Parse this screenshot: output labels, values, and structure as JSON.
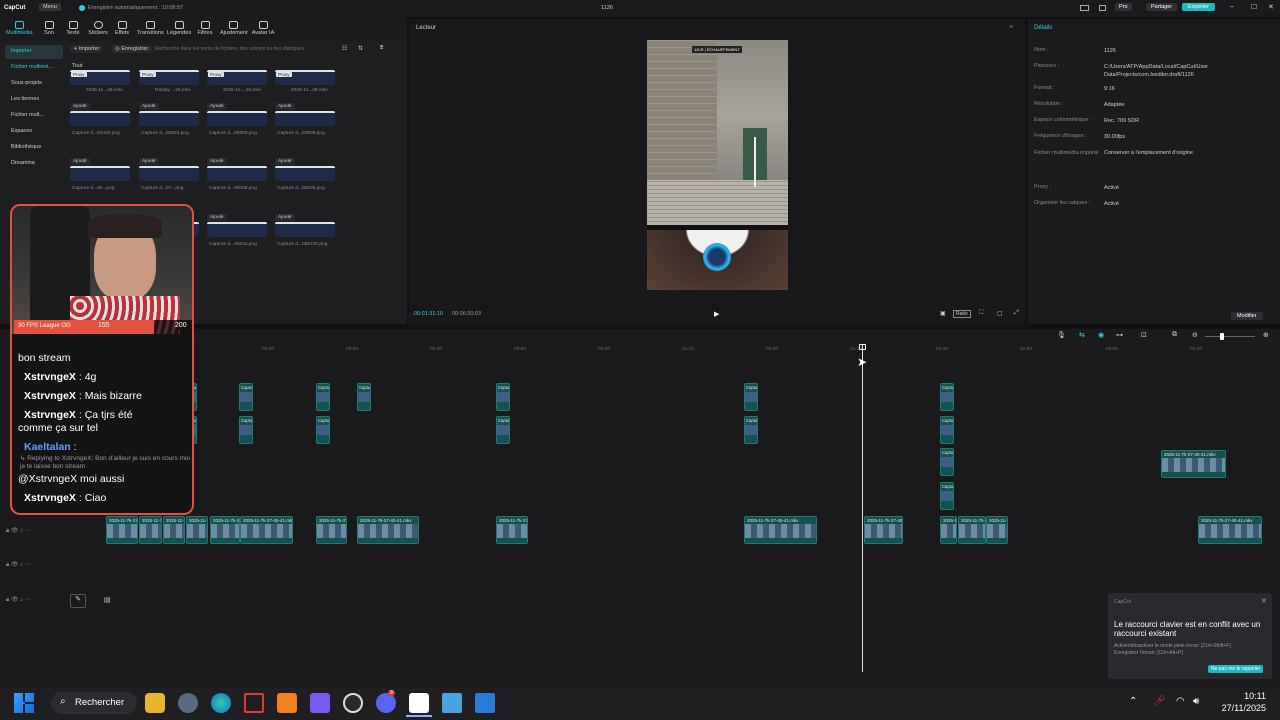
{
  "titlebar": {
    "app_name": "CapCut",
    "menu_label": "Menu",
    "autosave": "Enregistré automatiquement : 10:08:57",
    "project_name": "1126",
    "pro_label": "Pro",
    "share_label": "Partager",
    "export_label": "Exporter"
  },
  "toolbar": [
    "Multimédia",
    "Son",
    "Texte",
    "Stickers",
    "Effets",
    "Transitions",
    "Légendes",
    "Filtres",
    "Ajustement",
    "Avatar IA"
  ],
  "sidenav": [
    "Importer",
    "Fichier multimé...",
    "Sous-projets",
    "Les tiennes",
    "Fichier mult...",
    "Espaces",
    "Bibliothèque",
    "Dreamina"
  ],
  "media": {
    "import_btn": "Importer",
    "record_btn": "Enregistrer",
    "search_placeholder": "Recherche dans les noms de fichiers, des scènes ou des dialogues",
    "section": "Tout",
    "proxy_badge": "Proxy",
    "added_label": "Ajouté",
    "items": [
      {
        "cap": "2025-11...48.mkv"
      },
      {
        "cap": "Replay ...26.mkv"
      },
      {
        "cap": "2025-11-...25.mkv"
      },
      {
        "cap": "2025-11...39.mkv"
      },
      {
        "cap": "Capture d...84448.png"
      },
      {
        "cap": "Capture d...84824.png"
      },
      {
        "cap": "Capture d...85950.png"
      },
      {
        "cap": "Capture d...84809.png"
      },
      {
        "cap": "Capture d...86...png"
      },
      {
        "cap": "Capture d...87...png"
      },
      {
        "cap": "Capture d...90006.png"
      },
      {
        "cap": "Capture d...85836.png"
      },
      {
        "cap": "Capture d...54...png"
      },
      {
        "cap": "Capture d...84...png"
      },
      {
        "cap": "Capture d...4824a.png"
      },
      {
        "cap": "Capture d...085720.png"
      }
    ]
  },
  "player": {
    "title": "Lecteur",
    "current_time": "00:01:31:10",
    "total_time": "00:06:30:03",
    "ratio_label": "Ratio",
    "hud_left": "12LR",
    "hud_right": "ÉCHAUFFEMENT"
  },
  "details": {
    "title": "Détails",
    "rows": [
      {
        "label": "Nom :",
        "value": "1126"
      },
      {
        "label": "Parcours :",
        "value": "C:/Users/ATP/AppData/Local/CapCut/User Data/Projects/com.lveditor.draft/1126"
      },
      {
        "label": "Format :",
        "value": "9:16"
      },
      {
        "label": "Résolution :",
        "value": "Adaptée"
      },
      {
        "label": "Espace colorimétrique :",
        "value": "Rec. 709 SDR"
      },
      {
        "label": "Fréquence d'images :",
        "value": "30.00fps"
      },
      {
        "label": "Fichier multimédia importé :",
        "value": "Conserver à l'emplacement d'origine"
      },
      {
        "label": "Proxy :",
        "value": "Activé"
      },
      {
        "label": "Organiser les calques :",
        "value": "Activé"
      }
    ],
    "modify_btn": "Modifier"
  },
  "timeline": {
    "ticks": [
      "00:00",
      "00:20",
      "00:30",
      "00:40",
      "00:50",
      "01:00",
      "01:10",
      "01:20",
      "01:30",
      "01:40",
      "01:50",
      "02:00",
      "02:10"
    ],
    "clip_label": "2025-11-7k-27-40-41.mkv",
    "capture_label": "Captu"
  },
  "stream_overlay": {
    "goal_label": "30 FPS League OG",
    "goal_current": "155",
    "goal_target": "200",
    "chat": [
      {
        "user": "",
        "text": "bon stream"
      },
      {
        "user": "XstrvngeX",
        "text": " : 4g"
      },
      {
        "user": "XstrvngeX",
        "text": " : Mais bizarre"
      },
      {
        "user": "XstrvngeX",
        "text": " : Ça tjrs été"
      },
      {
        "user": "",
        "text": "comme ça sur tel"
      },
      {
        "user": "Kaeltalan",
        "text": " :"
      },
      {
        "user": "",
        "text": "↳ Replying to XstrvngeX: Bon d'ailleur je suis en cours moi je te laisse bon stream"
      },
      {
        "user": "",
        "text": "@XstrvngeX moi aussi"
      },
      {
        "user": "XstrvngeX",
        "text": " : Ciao"
      }
    ]
  },
  "toast": {
    "app": "CapCut",
    "title": "Le raccourci clavier est en conflit avec un raccourci existant",
    "line1": "Activer/désactiver le mode plein écran: [Ctrl+Shift+F]",
    "line2": "Enregistrer l'écran: [Ctrl+Alt+P]",
    "button": "Ne pas me le rappeler"
  },
  "taskbar": {
    "search_label": "Rechercher",
    "time": "10:11",
    "date": "27/11/2025",
    "discord_badge": "9"
  },
  "colors": {
    "accent": "#2fd0d8",
    "clip": "#14514f",
    "overlay_border": "#e2523f"
  }
}
